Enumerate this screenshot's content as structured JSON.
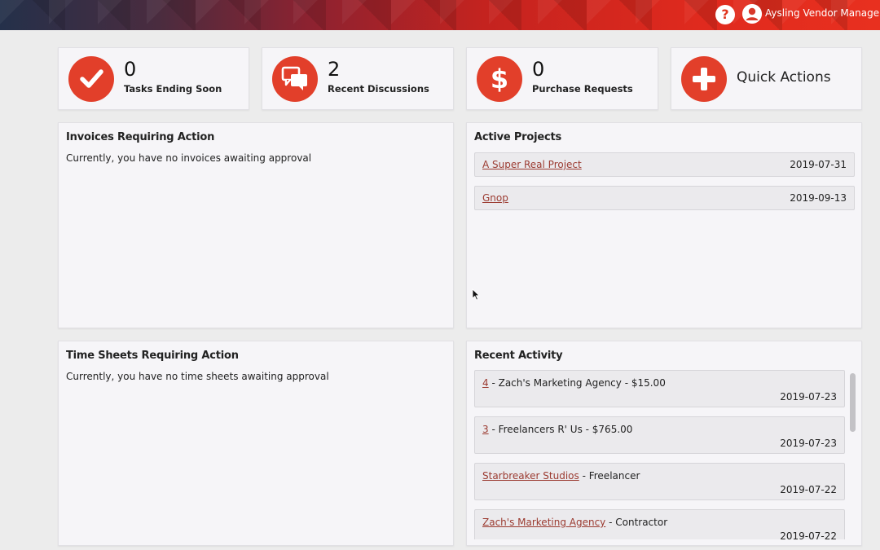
{
  "header": {
    "help_icon": "?",
    "user_name": "Aysling Vendor Management"
  },
  "stats": [
    {
      "icon": "checkmark-icon",
      "value": "0",
      "label": "Tasks Ending Soon"
    },
    {
      "icon": "chat-bubbles-icon",
      "value": "2",
      "label": "Recent Discussions"
    },
    {
      "icon": "dollar-icon",
      "value": "0",
      "label": "Purchase Requests"
    },
    {
      "icon": "plus-icon",
      "label": "Quick Actions"
    }
  ],
  "invoices": {
    "title": "Invoices Requiring Action",
    "message": "Currently, you have no invoices awaiting approval"
  },
  "projects": {
    "title": "Active Projects",
    "items": [
      {
        "name": "A Super Real Project",
        "date": "2019-07-31"
      },
      {
        "name": "Gnop",
        "date": "2019-09-13"
      }
    ]
  },
  "timesheets": {
    "title": "Time Sheets Requiring Action",
    "message": "Currently, you have no time sheets awaiting approval"
  },
  "activity": {
    "title": "Recent Activity",
    "items": [
      {
        "link": "4",
        "text": " - Zach's Marketing Agency - $15.00",
        "date": "2019-07-23"
      },
      {
        "link": "3",
        "text": " - Freelancers R' Us - $765.00",
        "date": "2019-07-23"
      },
      {
        "link": "Starbreaker Studios",
        "text": " - Freelancer",
        "date": "2019-07-22"
      },
      {
        "link": "Zach's Marketing Agency",
        "text": " - Contractor",
        "date": "2019-07-22"
      }
    ]
  },
  "colors": {
    "accent": "#e23f2a",
    "link": "#9b3a30",
    "card_bg": "#f6f5f8",
    "page_bg": "#ececec"
  }
}
